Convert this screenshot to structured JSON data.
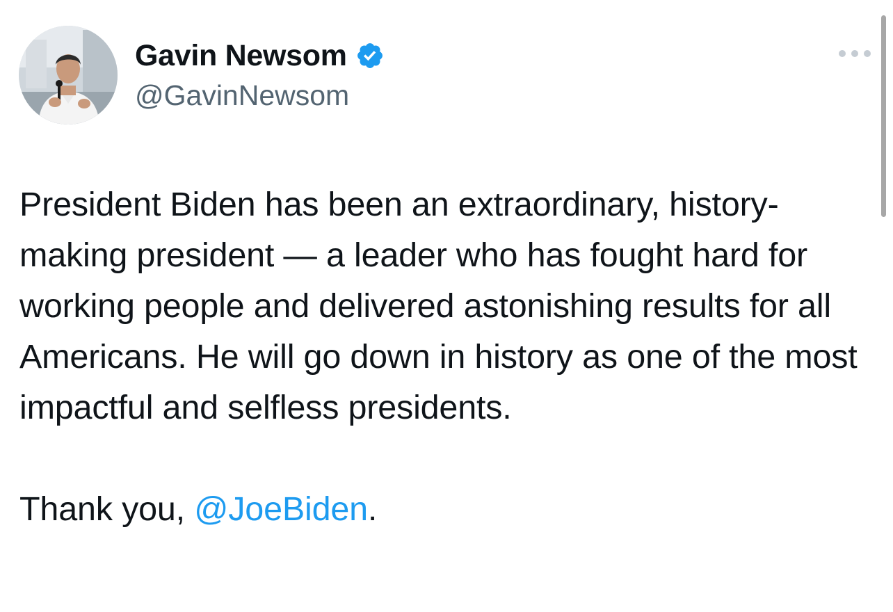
{
  "author": {
    "display_name": "Gavin Newsom",
    "handle": "@GavinNewsom",
    "verified": true,
    "verified_badge_color": "#1d9bf0"
  },
  "tweet": {
    "paragraph_1": "President Biden has been an extraordinary, history-making president — a leader who has fought hard for working people and delivered astonishing results for all Americans. He will go down in history as one of the most impactful and selfless presidents.",
    "thanks_prefix": "Thank you, ",
    "mention": "@JoeBiden",
    "thanks_suffix": "."
  },
  "icons": {
    "more": "more-options-icon",
    "verified": "verified-badge-icon"
  },
  "colors": {
    "text": "#0f1419",
    "secondary_text": "#536471",
    "link": "#1d9bf0"
  }
}
